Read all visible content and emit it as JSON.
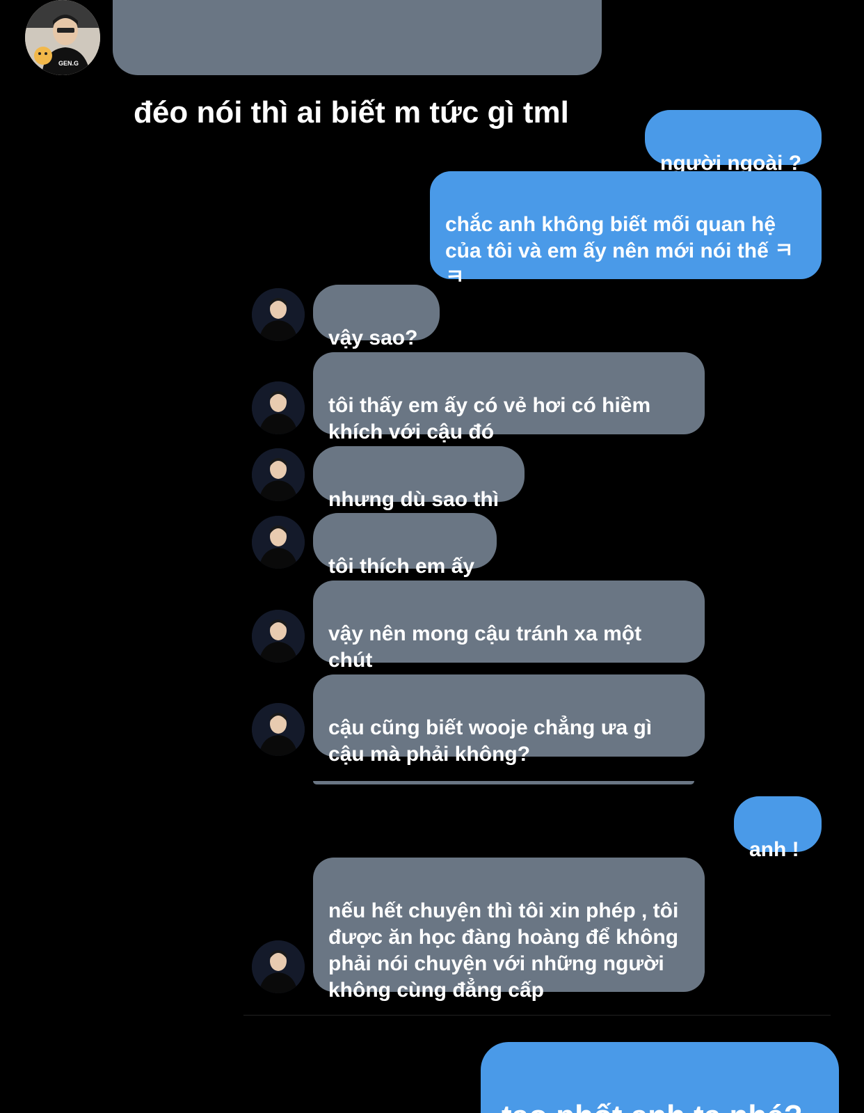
{
  "top_message": {
    "text": "đéo nói thì ai biết m tức gì tml"
  },
  "messages": {
    "m1": "người ngoài ?",
    "m2": "chắc anh không biết mối quan hệ của tôi và em ấy nên mới nói thế ㅋ\nㅋ",
    "m3": "vậy sao?",
    "m4": "tôi thấy em ấy có vẻ hơi có hiềm khích với cậu đó",
    "m5": "nhưng dù sao thì",
    "m6": "tôi thích em ấy",
    "m7": "vậy nên mong cậu tránh xa một chút",
    "m8": "cậu cũng biết wooje chẳng ưa gì cậu mà phải không?",
    "m9": "anh !",
    "m10": "nếu hết chuyện thì tôi xin phép , tôi được ăn học đàng hoàng để không phải nói chuyện với những người không cùng đẳng cấp"
  },
  "bottom_message": {
    "text": "tao phốt anh ta nhé?"
  },
  "colors": {
    "background": "#000000",
    "incoming_bubble": "#6a7684",
    "outgoing_bubble": "#4a9ae8",
    "text": "#ffffff"
  },
  "avatar_badge": "GEN.G"
}
